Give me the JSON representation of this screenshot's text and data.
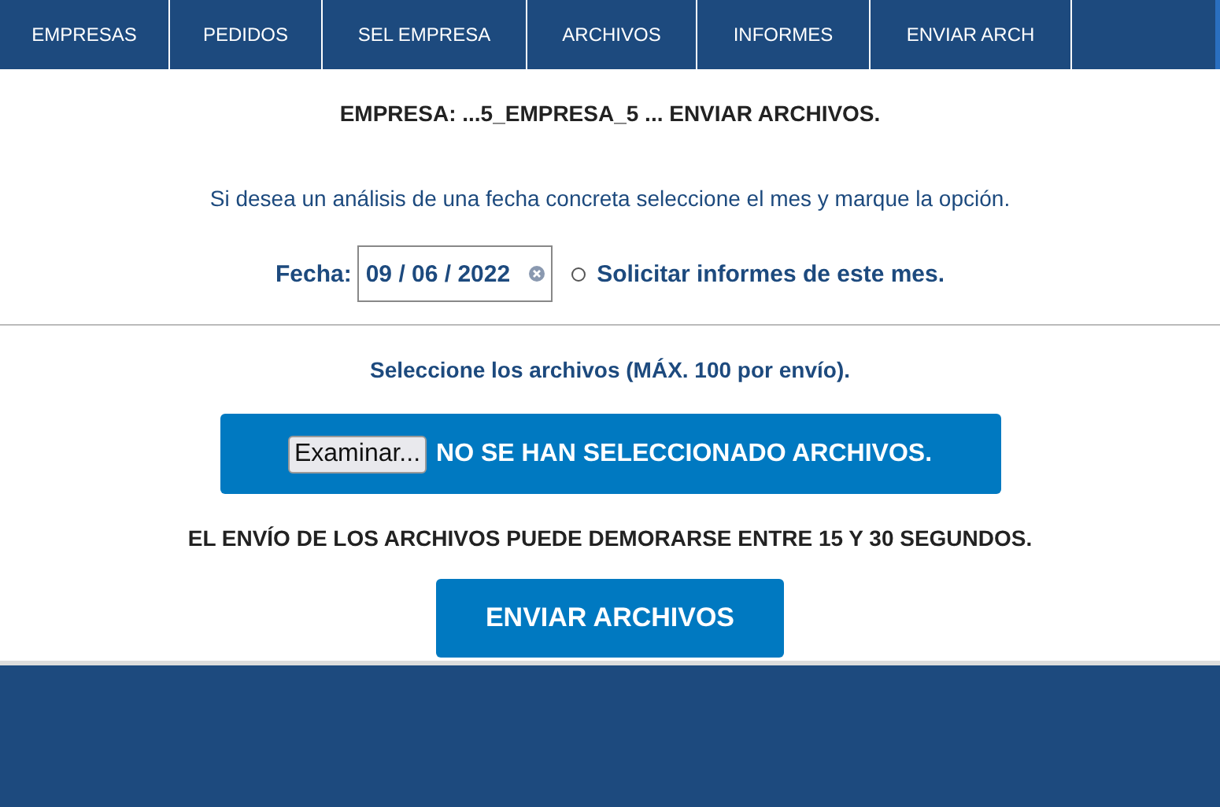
{
  "nav": [
    {
      "label": "EMPRESAS",
      "selected": false
    },
    {
      "label": "PEDIDOS",
      "selected": false
    },
    {
      "label": "SEL EMPRESA",
      "selected": false
    },
    {
      "label": "ARCHIVOS",
      "selected": false
    },
    {
      "label": "INFORMES",
      "selected": false
    },
    {
      "label": "ENVIAR ARCH",
      "selected": false
    }
  ],
  "heading": "EMPRESA: ...5_EMPRESA_5 ... ENVIAR ARCHIVOS.",
  "instructions": "Si desea un análisis de una fecha concreta seleccione el mes y marque la opción.",
  "date": {
    "label": "Fecha:",
    "value": "09 / 06 / 2022"
  },
  "monthly_option": {
    "label": "Solicitar informes de este mes.",
    "checked": false
  },
  "files_prompt": "Seleccione los archivos (MÁX. 100 por envío).",
  "file_picker": {
    "button": "Examinar...",
    "status": "NO SE HAN SELECCIONADO ARCHIVOS."
  },
  "notice": "EL ENVÍO DE LOS ARCHIVOS PUEDE DEMORARSE ENTRE 15 Y 30 SEGUNDOS.",
  "submit": "ENVIAR ARCHIVOS"
}
